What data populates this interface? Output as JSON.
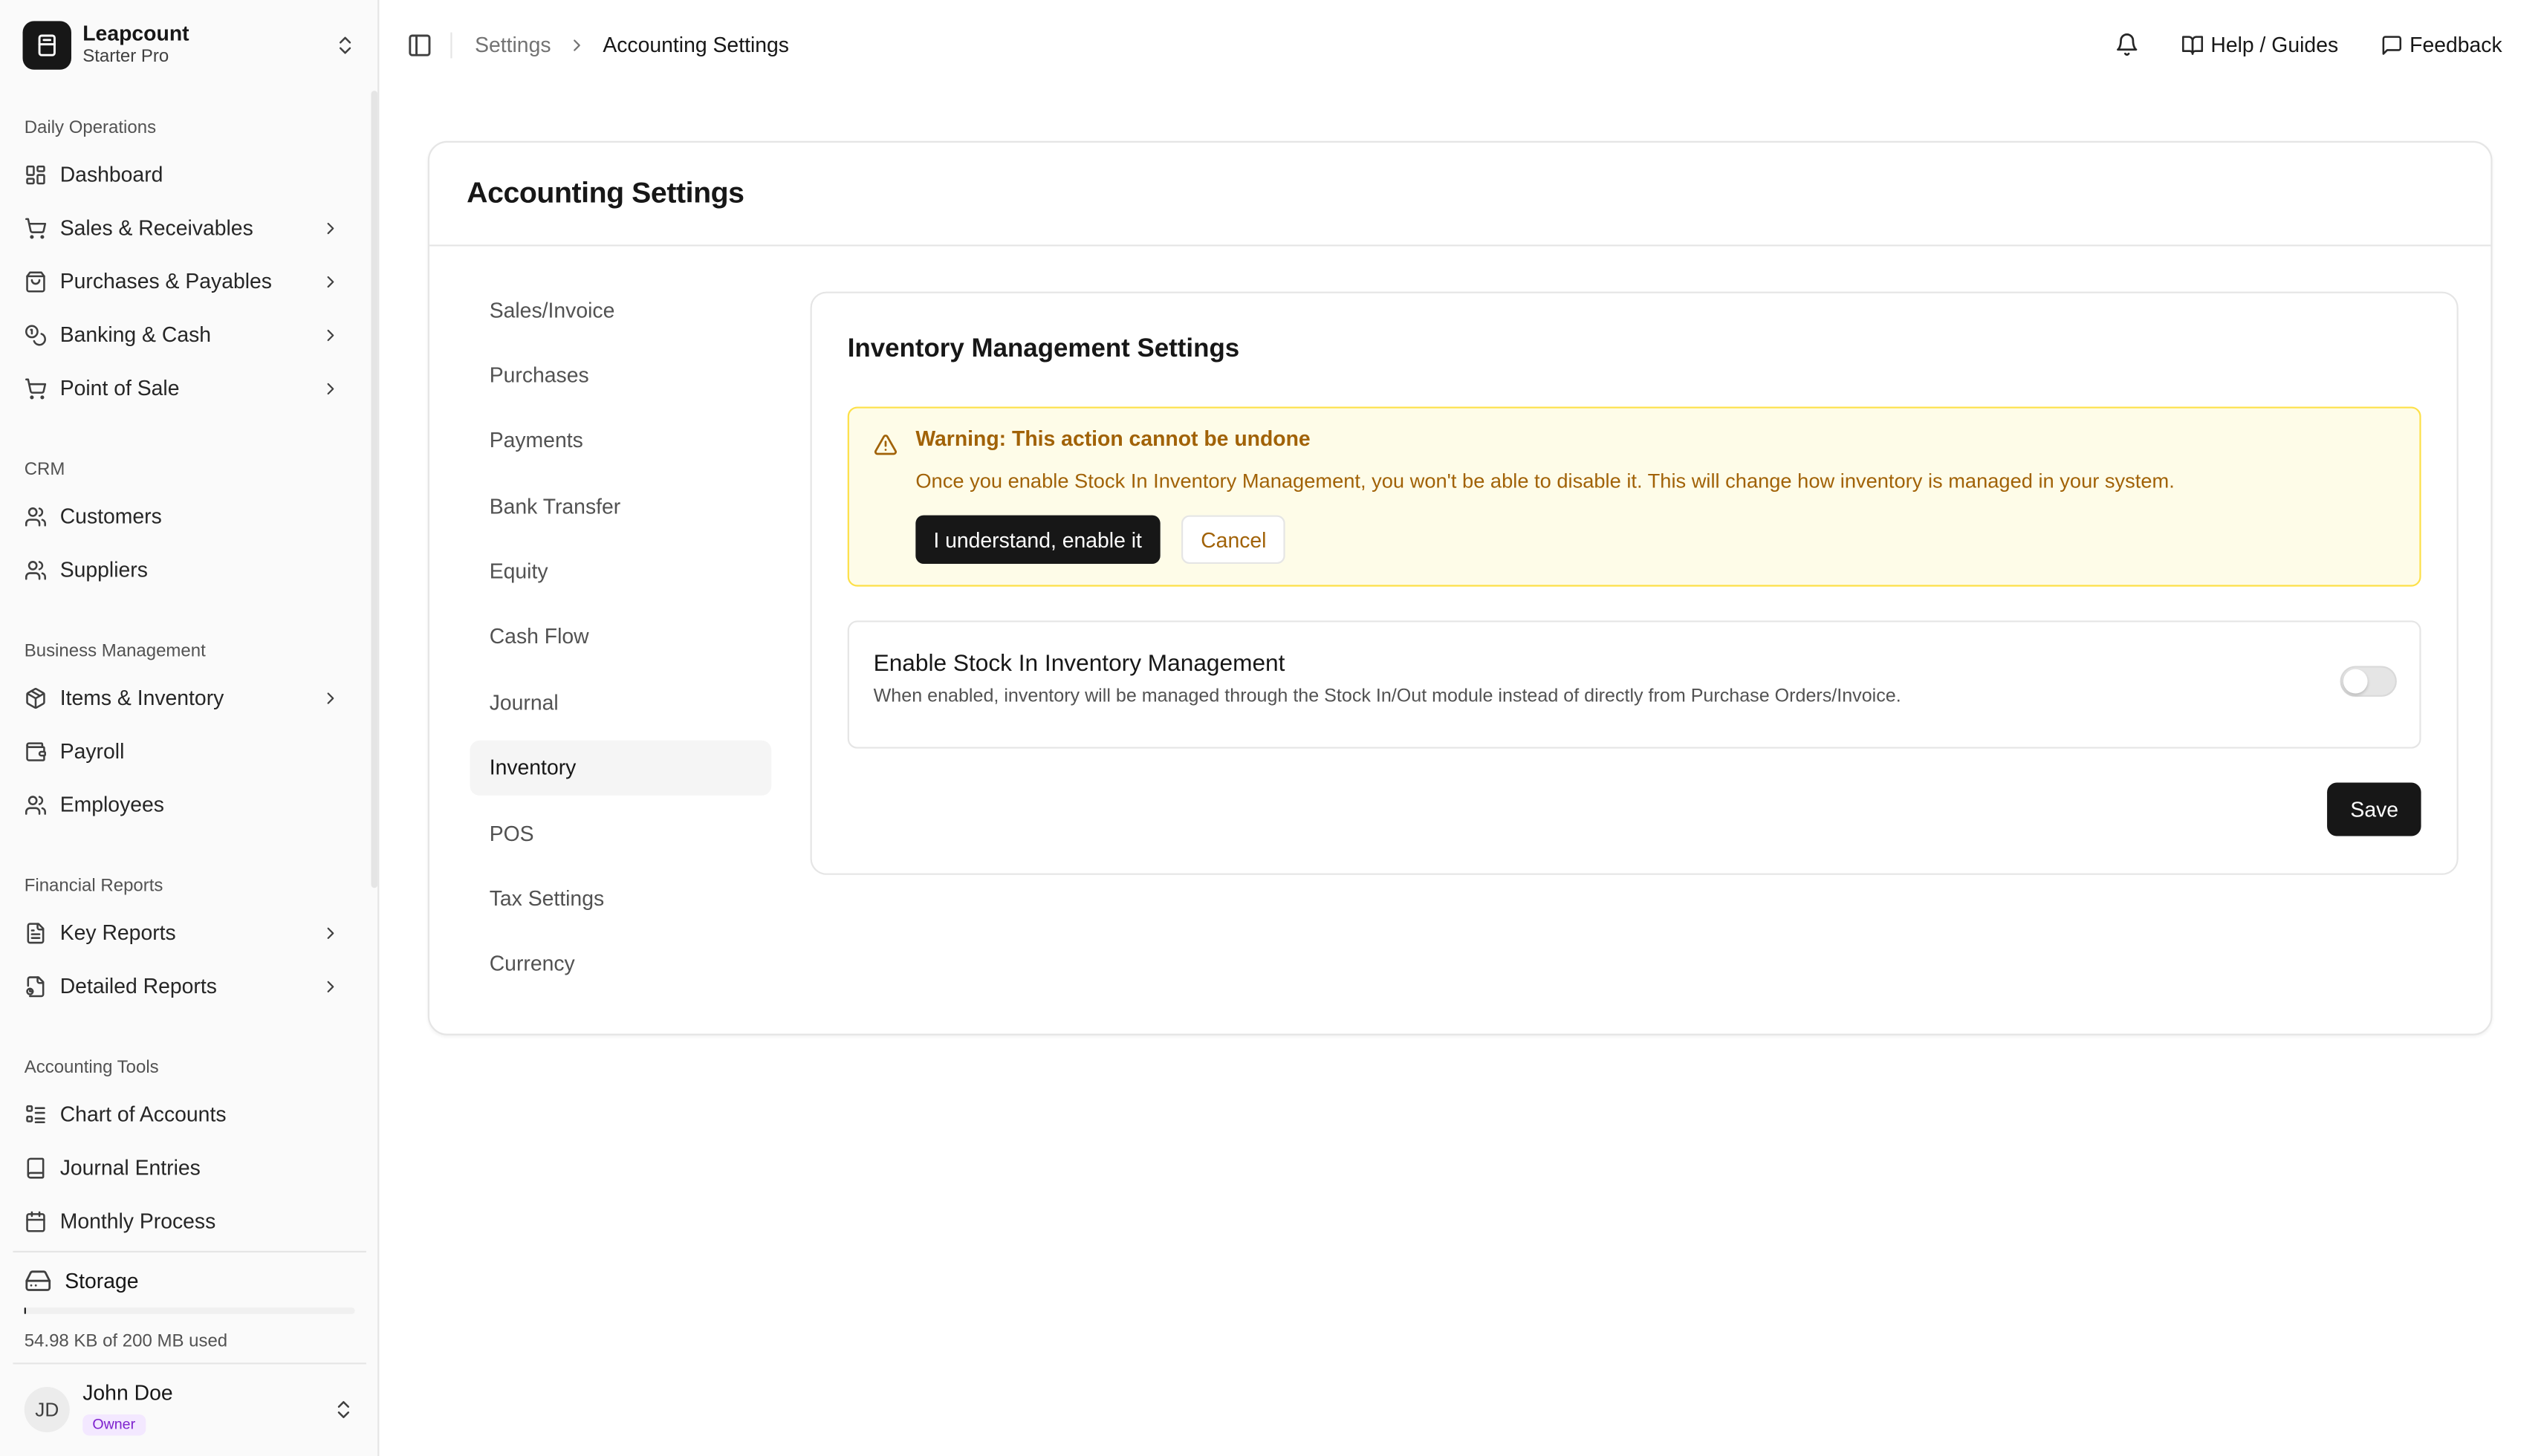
{
  "brand": {
    "name": "Leapcount",
    "plan": "Starter Pro"
  },
  "sidebar": {
    "groups": [
      {
        "label": "Daily Operations",
        "items": [
          {
            "label": "Dashboard",
            "icon": "dashboard-icon",
            "chevron": false
          },
          {
            "label": "Sales & Receivables",
            "icon": "cart-icon",
            "chevron": true
          },
          {
            "label": "Purchases & Payables",
            "icon": "shopping-bag-icon",
            "chevron": true
          },
          {
            "label": "Banking & Cash",
            "icon": "coins-icon",
            "chevron": true
          },
          {
            "label": "Point of Sale",
            "icon": "cart-icon",
            "chevron": true
          }
        ]
      },
      {
        "label": "CRM",
        "items": [
          {
            "label": "Customers",
            "icon": "users-icon",
            "chevron": false
          },
          {
            "label": "Suppliers",
            "icon": "users-icon",
            "chevron": false
          }
        ]
      },
      {
        "label": "Business Management",
        "items": [
          {
            "label": "Items & Inventory",
            "icon": "package-icon",
            "chevron": true
          },
          {
            "label": "Payroll",
            "icon": "wallet-icon",
            "chevron": false
          },
          {
            "label": "Employees",
            "icon": "users-icon",
            "chevron": false
          }
        ]
      },
      {
        "label": "Financial Reports",
        "items": [
          {
            "label": "Key Reports",
            "icon": "file-text-icon",
            "chevron": true
          },
          {
            "label": "Detailed Reports",
            "icon": "file-chart-icon",
            "chevron": true
          }
        ]
      },
      {
        "label": "Accounting Tools",
        "items": [
          {
            "label": "Chart of Accounts",
            "icon": "list-tree-icon",
            "chevron": false
          },
          {
            "label": "Journal Entries",
            "icon": "book-icon",
            "chevron": false
          },
          {
            "label": "Monthly Process",
            "icon": "calendar-icon",
            "chevron": false
          }
        ]
      }
    ]
  },
  "storage": {
    "label": "Storage",
    "usage_text": "54.98 KB of 200 MB used",
    "used_fraction": 0.0003
  },
  "user": {
    "initials": "JD",
    "name": "John Doe",
    "role": "Owner"
  },
  "topbar": {
    "breadcrumb_parent": "Settings",
    "breadcrumb_current": "Accounting Settings",
    "help_label": "Help / Guides",
    "feedback_label": "Feedback"
  },
  "page": {
    "title": "Accounting Settings",
    "subnav": [
      "Sales/Invoice",
      "Purchases",
      "Payments",
      "Bank Transfer",
      "Equity",
      "Cash Flow",
      "Journal",
      "Inventory",
      "POS",
      "Tax Settings",
      "Currency"
    ],
    "subnav_active": "Inventory",
    "panel_title": "Inventory Management Settings",
    "warning": {
      "title": "Warning: This action cannot be undone",
      "text": "Once you enable Stock In Inventory Management, you won't be able to disable it. This will change how inventory is managed in your system.",
      "confirm_label": "I understand, enable it",
      "cancel_label": "Cancel"
    },
    "setting": {
      "title": "Enable Stock In Inventory Management",
      "description": "When enabled, inventory will be managed through the Stock In/Out module instead of directly from Purchase Orders/Invoice.",
      "enabled": false
    },
    "save_label": "Save"
  },
  "colors": {
    "accent": "#171717",
    "warning_text": "#a16207",
    "warning_bg": "#fefce8",
    "warning_border": "#fde047",
    "role_badge": "#7e22ce"
  }
}
